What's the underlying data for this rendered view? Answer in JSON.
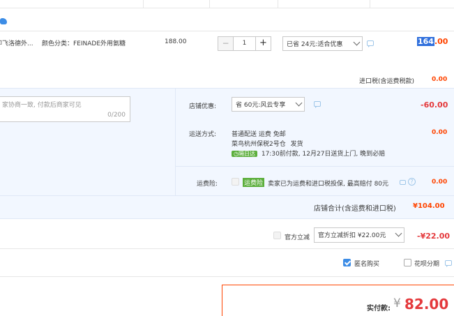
{
  "item": {
    "name": "即飞洛德外...",
    "sku": "颜色分类：FEINADE外用氨糖",
    "price": "188.00",
    "qty_minus": "−",
    "qty": "1",
    "qty_plus": "+",
    "promo_select": "已省 24元:适合优惠",
    "subtotal_hl": "164",
    "subtotal_rest": ".00",
    "import_tax_label": "进口税(含运费税款)",
    "import_tax_value": "0.00"
  },
  "message": {
    "placeholder": "选填:请先和商家协商一致, 付款后商家可见",
    "placeholder_visible": "家协商一致, 付款后商家可见",
    "counter": "0/200"
  },
  "shop": {
    "discount_label": "店铺优惠:",
    "discount_select": "省 60元:风云专享",
    "discount_value": "-60.00",
    "shipping_label": "运送方式:",
    "shipping_method": "普通配送 运费 免邮",
    "warehouse": "菜鸟杭州保税2号仓",
    "ship_note": "发货",
    "eta_badge": "隔日达",
    "eta_text": "17:30前付款, 12月27日送货上门, 晚到必赔",
    "shipping_value": "0.00",
    "insurance_label": "运费险:",
    "insurance_badge": "运费险",
    "insurance_text": "卖家已为运费和进口税投保, 最高赔付 80元",
    "insurance_value": "0.00",
    "total_label": "店铺合计(含运费和进口税)",
    "total_value": "¥104.00"
  },
  "official": {
    "label": "官方立减",
    "select": "官方立减折扣 ¥22.00元",
    "value": "-¥22.00"
  },
  "options": {
    "anonymous": "匿名购买",
    "huabei": "花呗分期"
  },
  "pay": {
    "label": "实付款:",
    "currency": "¥",
    "amount": "82.00"
  },
  "colors": {
    "accent_red": "#e4393c",
    "orange": "#ff4400",
    "blue": "#3d8de6",
    "green": "#5bae3b"
  }
}
